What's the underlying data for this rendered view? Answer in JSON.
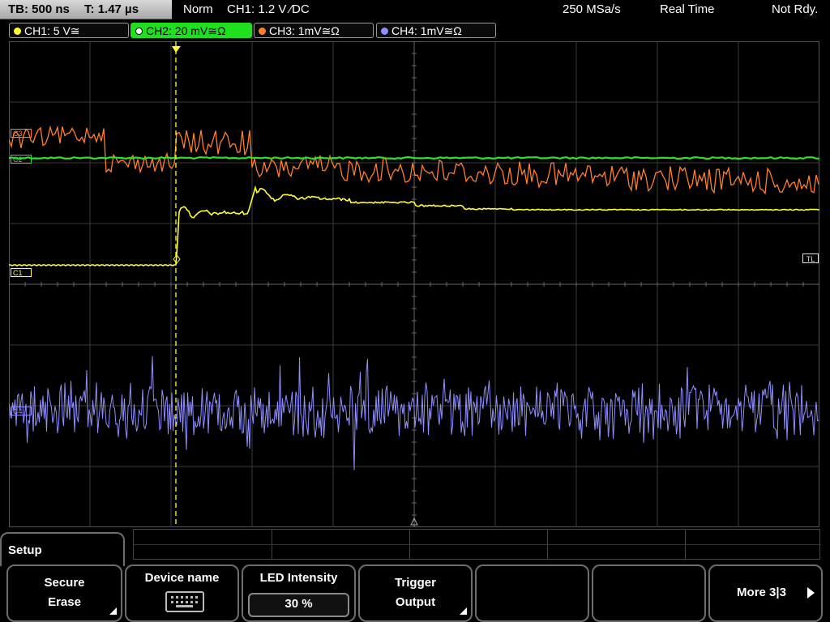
{
  "timebase": {
    "tb": "TB: 500 ns",
    "t": "T: 1.47 µs"
  },
  "status": {
    "mode": "Norm",
    "trigger": "CH1: 1.2 V ⁄DC",
    "sample_rate": "250 MSa/s",
    "acq": "Real Time",
    "state": "Not Rdy."
  },
  "channels": [
    {
      "label": "CH1: 5 V≅",
      "color": "#ffff33",
      "active": false
    },
    {
      "label": "CH2: 20 mV≅Ω",
      "color": "#2fe02f",
      "active": true
    },
    {
      "label": "CH3: 1mV≅Ω",
      "color": "#ff7f2a",
      "active": false
    },
    {
      "label": "CH4: 1mV≅Ω",
      "color": "#8f8fff",
      "active": false
    }
  ],
  "markers": {
    "c1": "C1",
    "c3": "C3",
    "c2": "C2",
    "c4": "C4",
    "tl": "TL",
    "trig": "T"
  },
  "menu": {
    "setup": "Setup",
    "secure_erase": [
      "Secure",
      "Erase"
    ],
    "device_name": "Device name",
    "led_intensity": "LED Intensity",
    "led_value": "30 %",
    "trigger_output": [
      "Trigger",
      "Output"
    ],
    "more": "More 3|3"
  },
  "colors": {
    "ch1": "#ffff33",
    "ch2": "#2fe02f",
    "ch3": "#ff7f2a",
    "ch4": "#8f8fff",
    "grid": "#5a5a5a"
  }
}
